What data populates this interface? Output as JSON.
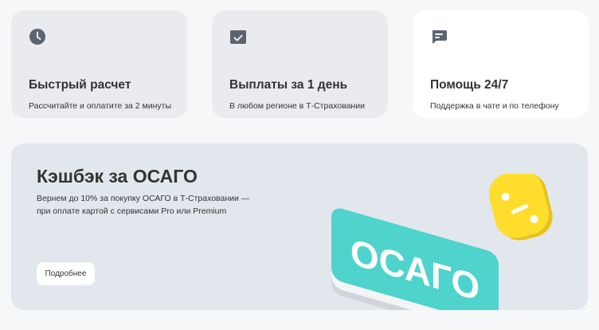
{
  "features": [
    {
      "icon": "clock-icon",
      "title": "Быстрый расчет",
      "subtitle": "Рассчитайте и оплатите за 2 минуты"
    },
    {
      "icon": "wallet-check-icon",
      "title": "Выплаты за 1 день",
      "subtitle": "В любом регионе в Т‑Страховании"
    },
    {
      "icon": "chat-icon",
      "title": "Помощь 24/7",
      "subtitle": "Поддержка в чате и по телефону"
    }
  ],
  "banner": {
    "title": "Кэшбэк за ОСАГО",
    "description_line1": "Вернем до 10% за покупку ОСАГО в Т‑Страховании —",
    "description_line2": "при оплате картой с сервисами Pro или Premium",
    "button_label": "Подробнее",
    "card_text": "ОСАГО"
  },
  "colors": {
    "page_bg": "#f6f7f8",
    "card_bg": "#e9ebee",
    "card_bg_active": "#ffffff",
    "banner_bg": "#e2e7ed",
    "text": "#333333",
    "icon": "#5c6470",
    "teal": "#4fd3cd",
    "yellow": "#ffdd2d"
  }
}
